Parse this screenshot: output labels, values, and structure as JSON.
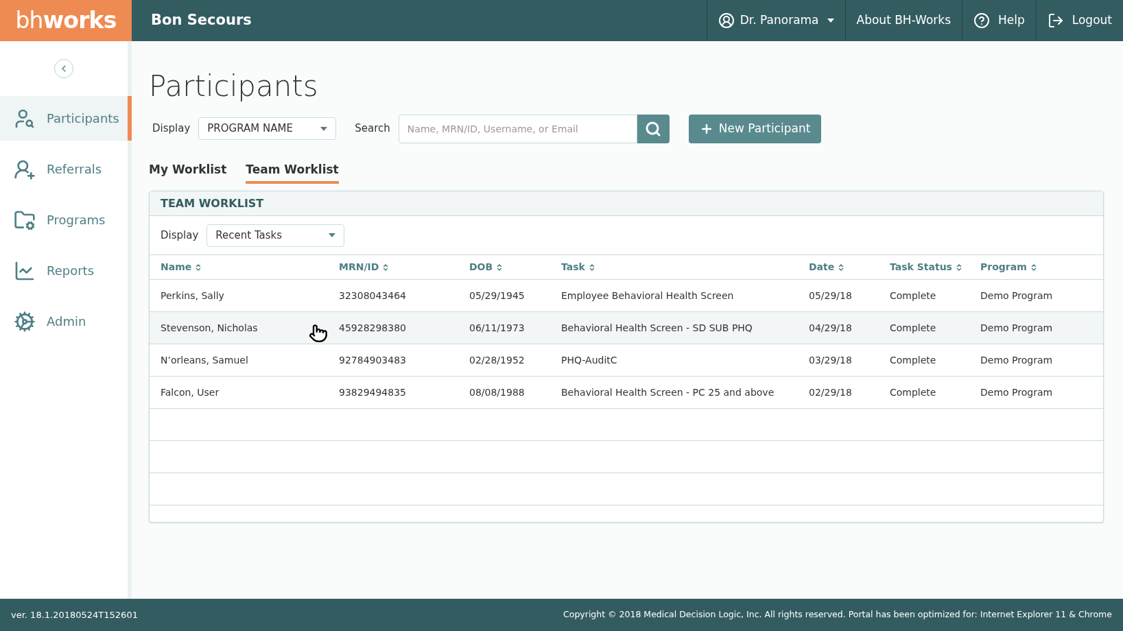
{
  "header": {
    "logo_light": "bh",
    "logo_bold": "works",
    "org": "Bon Secours",
    "user": "Dr. Panorama",
    "links": [
      {
        "kind": "about",
        "label": "About BH-Works"
      },
      {
        "kind": "help",
        "label": "Help"
      },
      {
        "kind": "logout",
        "label": "Logout"
      }
    ]
  },
  "sidebar": {
    "items": [
      {
        "kind": "participants",
        "label": "Participants",
        "selected": true
      },
      {
        "kind": "referrals",
        "label": "Referrals",
        "selected": false
      },
      {
        "kind": "programs",
        "label": "Programs",
        "selected": false
      },
      {
        "kind": "reports",
        "label": "Reports",
        "selected": false
      },
      {
        "kind": "admin",
        "label": "Admin",
        "selected": false
      }
    ]
  },
  "page": {
    "title": "Participants",
    "display_label": "Display",
    "display_value": "PROGRAM NAME",
    "search_label": "Search",
    "search_placeholder": "Name, MRN/ID, Username, or Email",
    "new_button": "New Participant"
  },
  "tabs": [
    {
      "label": "My Worklist",
      "selected": false
    },
    {
      "label": "Team Worklist",
      "selected": true
    }
  ],
  "panel": {
    "title": "TEAM WORKLIST",
    "display_label": "Display",
    "display_value": "Recent Tasks"
  },
  "table": {
    "columns": [
      "Name",
      "MRN/ID",
      "DOB",
      "Task",
      "Date",
      "Task Status",
      "Program"
    ],
    "rows": [
      {
        "hovered": false,
        "cells": [
          "Perkins, Sally",
          "32308043464",
          "05/29/1945",
          "Employee Behavioral Health Screen",
          "05/29/18",
          "Complete",
          "Demo Program"
        ]
      },
      {
        "hovered": true,
        "cells": [
          "Stevenson, Nicholas",
          "45928298380",
          "06/11/1973",
          "Behavioral Health Screen - SD SUB PHQ",
          "04/29/18",
          "Complete",
          "Demo Program"
        ]
      },
      {
        "hovered": false,
        "cells": [
          "N’orleans, Samuel",
          "92784903483",
          "02/28/1952",
          "PHQ-AuditC",
          "03/29/18",
          "Complete",
          "Demo Program"
        ]
      },
      {
        "hovered": false,
        "cells": [
          "Falcon, User",
          "93829494835",
          "08/08/1988",
          "Behavioral Health Screen - PC 25 and above",
          "02/29/18",
          "Complete",
          "Demo Program"
        ]
      }
    ]
  },
  "footer": {
    "version": "ver. 18.1.20180524T152601",
    "copyright": "Copyright © 2018 Medical Decision Logic, Inc. All rights reserved. Portal has been optimized for: Internet Explorer 11 & Chrome"
  }
}
